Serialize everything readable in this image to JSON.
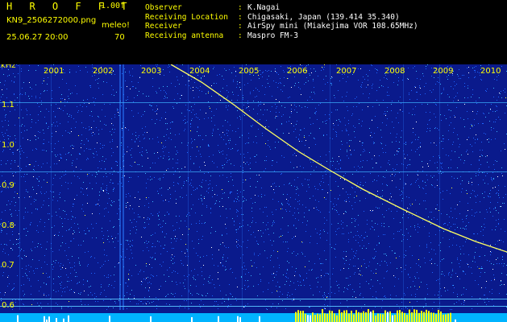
{
  "header": {
    "title": "H R O F F T",
    "version": "1.00f",
    "filename": "KN9_2506272000.png",
    "meleo": "meleo!",
    "datetime": "25.06.27 20:00",
    "value": "70"
  },
  "info": {
    "rows": [
      {
        "key": "Observer",
        "sep": ":",
        "value": "K.Nagai"
      },
      {
        "key": "Receiving Location",
        "sep": ":",
        "value": "Chigasaki, Japan (139.414 35.340)"
      },
      {
        "key": "Receiver",
        "sep": ":",
        "value": "AirSpy mini (Miakejima VOR 108.65MHz)"
      },
      {
        "key": "Receiving antenna",
        "sep": ":",
        "value": "Maspro FM-3"
      }
    ]
  },
  "chart_data": {
    "type": "heatmap",
    "ylabel": "kHz",
    "y_ticks": [
      "1.1",
      "1.0",
      "0.9",
      "0.8",
      "0.7",
      "0.6"
    ],
    "x_ticks": [
      "2001",
      "2002",
      "2003",
      "2004",
      "2005",
      "2006",
      "2007",
      "2008",
      "2009",
      "2010"
    ],
    "colors": {
      "background": "#0a1a8c",
      "noise": [
        "#1e64ff",
        "#3cb4ff",
        "#ffffff",
        "#ffff40"
      ],
      "text": "#ffff00",
      "bar": "#00b4ff",
      "bar_high": "#ffff00"
    }
  }
}
